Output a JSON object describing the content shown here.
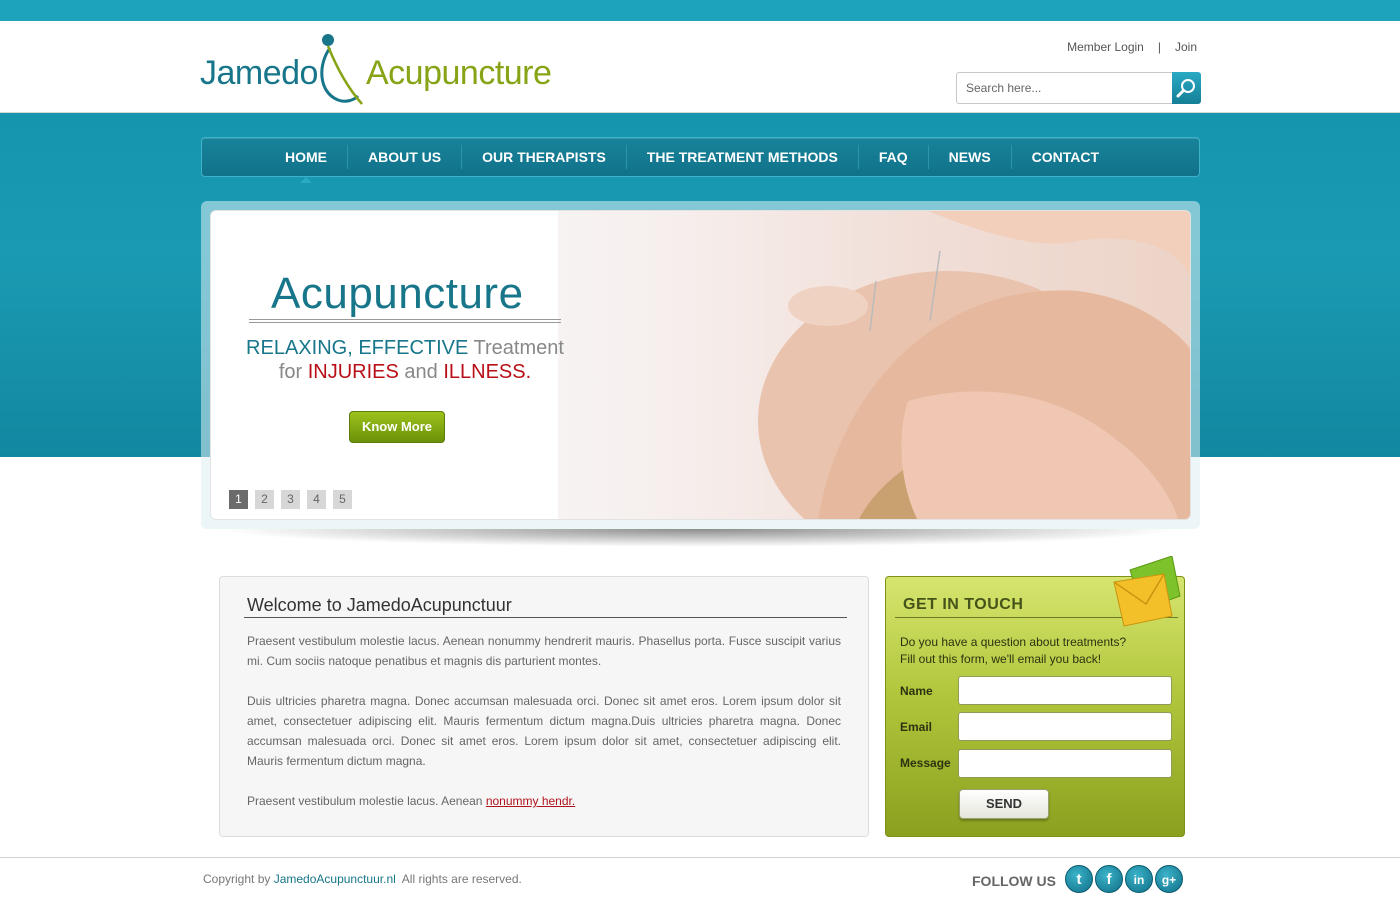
{
  "header": {
    "logo_word1": "Jamedo",
    "logo_word2": "Acupuncture",
    "links": {
      "member_login": "Member Login",
      "separator": "|",
      "join": "Join"
    },
    "search_placeholder": "Search here..."
  },
  "nav": {
    "items": [
      {
        "label": "HOME",
        "active": true
      },
      {
        "label": "ABOUT US"
      },
      {
        "label": "OUR THERAPISTS"
      },
      {
        "label": "THE TREATMENT METHODS"
      },
      {
        "label": "FAQ"
      },
      {
        "label": "NEWS"
      },
      {
        "label": "CONTACT"
      }
    ]
  },
  "hero": {
    "title": "Acupuncture",
    "line1": {
      "a": "RELAXING",
      "b": ", ",
      "c": "EFFECTIVE",
      "d": " Treatment"
    },
    "line2": {
      "a": "for ",
      "b": "INJURIES",
      "c": " and ",
      "d": "ILLNESS."
    },
    "button": "Know More",
    "pager": [
      "1",
      "2",
      "3",
      "4",
      "5"
    ],
    "active_page": "1"
  },
  "welcome": {
    "title": "Welcome to JamedoAcupunctuur",
    "p1": "Praesent vestibulum molestie lacus. Aenean nonummy hendrerit mauris. Phasellus porta. Fusce suscipit varius mi. Cum sociis natoque penatibus et magnis dis parturient montes.",
    "p2": "Duis ultricies pharetra magna. Donec accumsan malesuada orci. Donec sit amet eros. Lorem ipsum dolor sit amet, consectetuer adipiscing elit. Mauris fermentum dictum magna.Duis ultricies pharetra magna. Donec accumsan malesuada orci. Donec sit amet eros. Lorem ipsum dolor sit amet, consectetuer adipiscing elit. Mauris fermentum dictum magna.",
    "p3_text": "Praesent vestibulum molestie lacus. Aenean ",
    "p3_link": "nonummy hendr. "
  },
  "contact": {
    "title": "GET IN TOUCH",
    "question1": "Do you have a question about treatments?",
    "question2": "Fill out this form, we'll email you back!",
    "name_label": "Name",
    "email_label": "Email",
    "message_label": "Message",
    "send": "SEND"
  },
  "footer": {
    "copy_prefix": "Copyright by ",
    "copy_link": "JamedoAcupunctuur.nl",
    "copy_suffix": "  All rights are reserved.",
    "follow": "FOLLOW US",
    "socials": [
      {
        "name": "twitter",
        "glyph": "t"
      },
      {
        "name": "facebook",
        "glyph": "f"
      },
      {
        "name": "linkedin",
        "glyph": "in"
      },
      {
        "name": "google-plus",
        "glyph": "g+"
      }
    ]
  },
  "colors": {
    "teal": "#17768a",
    "top_strip": "#1ea3bd",
    "green": "#86a415",
    "red": "#b90f17"
  }
}
